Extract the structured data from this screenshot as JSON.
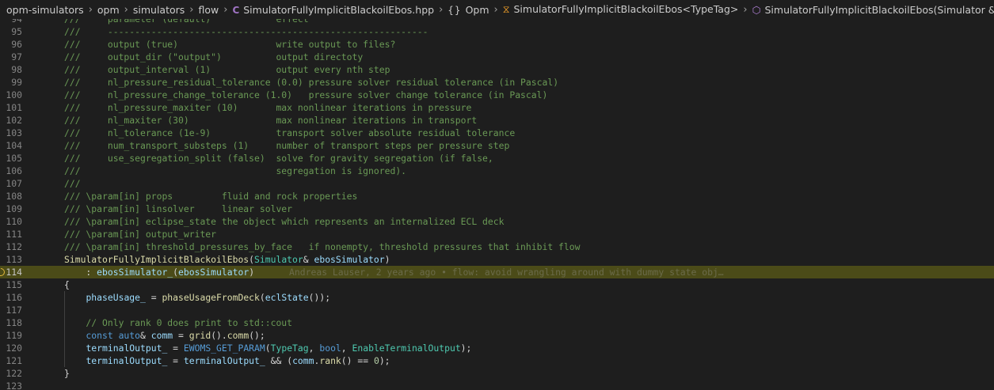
{
  "breadcrumb": {
    "items": [
      {
        "label": "opm-simulators",
        "icon": ""
      },
      {
        "label": "opm",
        "icon": ""
      },
      {
        "label": "simulators",
        "icon": ""
      },
      {
        "label": "flow",
        "icon": ""
      },
      {
        "label": "SimulatorFullyImplicitBlackoilEbos.hpp",
        "icon": "cpp-header-file-icon"
      },
      {
        "label": "Opm",
        "icon": "namespace-icon"
      },
      {
        "label": "SimulatorFullyImplicitBlackoilEbos<TypeTag>",
        "icon": "class-icon"
      },
      {
        "label": "SimulatorFullyImplicitBlackoilEbos(Simulator &)",
        "icon": "method-icon"
      }
    ]
  },
  "editor": {
    "current_line": "114",
    "blame": "Andreas Lauser, 2 years ago • flow: avoid wrangling around with dummy state obj…",
    "lines": [
      {
        "n": "94",
        "t": [
          [
            "cm",
            "///     parameter (default)            effect"
          ]
        ]
      },
      {
        "n": "95",
        "t": [
          [
            "cm",
            "///     -----------------------------------------------------------"
          ]
        ]
      },
      {
        "n": "96",
        "t": [
          [
            "cm",
            "///     output (true)                  write output to files?"
          ]
        ]
      },
      {
        "n": "97",
        "t": [
          [
            "cm",
            "///     output_dir (\"output\")          output directoty"
          ]
        ]
      },
      {
        "n": "98",
        "t": [
          [
            "cm",
            "///     output_interval (1)            output every nth step"
          ]
        ]
      },
      {
        "n": "99",
        "t": [
          [
            "cm",
            "///     nl_pressure_residual_tolerance (0.0) pressure solver residual tolerance (in Pascal)"
          ]
        ]
      },
      {
        "n": "100",
        "t": [
          [
            "cm",
            "///     nl_pressure_change_tolerance (1.0)   pressure solver change tolerance (in Pascal)"
          ]
        ]
      },
      {
        "n": "101",
        "t": [
          [
            "cm",
            "///     nl_pressure_maxiter (10)       max nonlinear iterations in pressure"
          ]
        ]
      },
      {
        "n": "102",
        "t": [
          [
            "cm",
            "///     nl_maxiter (30)                max nonlinear iterations in transport"
          ]
        ]
      },
      {
        "n": "103",
        "t": [
          [
            "cm",
            "///     nl_tolerance (1e-9)            transport solver absolute residual tolerance"
          ]
        ]
      },
      {
        "n": "104",
        "t": [
          [
            "cm",
            "///     num_transport_substeps (1)     number of transport steps per pressure step"
          ]
        ]
      },
      {
        "n": "105",
        "t": [
          [
            "cm",
            "///     use_segregation_split (false)  solve for gravity segregation (if false,"
          ]
        ]
      },
      {
        "n": "106",
        "t": [
          [
            "cm",
            "///                                    segregation is ignored)."
          ]
        ]
      },
      {
        "n": "107",
        "t": [
          [
            "cm",
            "///"
          ]
        ]
      },
      {
        "n": "108",
        "t": [
          [
            "cm",
            "/// \\param[in] props         fluid and rock properties"
          ]
        ]
      },
      {
        "n": "109",
        "t": [
          [
            "cm",
            "/// \\param[in] linsolver     linear solver"
          ]
        ]
      },
      {
        "n": "110",
        "t": [
          [
            "cm",
            "/// \\param[in] eclipse_state the object which represents an internalized ECL deck"
          ]
        ]
      },
      {
        "n": "111",
        "t": [
          [
            "cm",
            "/// \\param[in] output_writer"
          ]
        ]
      },
      {
        "n": "112",
        "t": [
          [
            "cm",
            "/// \\param[in] threshold_pressures_by_face   if nonempty, threshold pressures that inhibit flow"
          ]
        ]
      },
      {
        "n": "113",
        "t": [
          [
            "fn",
            "SimulatorFullyImplicitBlackoilEbos"
          ],
          [
            "pl",
            "("
          ],
          [
            "ty",
            "Simulator"
          ],
          [
            "pl",
            "& "
          ],
          [
            "var",
            "ebosSimulator"
          ],
          [
            "pl",
            ")"
          ]
        ]
      },
      {
        "n": "114",
        "t": [
          [
            "pl",
            "    : "
          ],
          [
            "var",
            "ebosSimulator_"
          ],
          [
            "pl",
            "("
          ],
          [
            "var",
            "ebosSimulator"
          ],
          [
            "pl",
            ")"
          ]
        ]
      },
      {
        "n": "115",
        "t": [
          [
            "pl",
            "{"
          ]
        ]
      },
      {
        "n": "116",
        "t": [
          [
            "pl",
            "    "
          ],
          [
            "var",
            "phaseUsage_"
          ],
          [
            "pl",
            " = "
          ],
          [
            "fn",
            "phaseUsageFromDeck"
          ],
          [
            "pl",
            "("
          ],
          [
            "var",
            "eclState"
          ],
          [
            "pl",
            "());"
          ]
        ]
      },
      {
        "n": "117",
        "t": []
      },
      {
        "n": "118",
        "t": [
          [
            "cm",
            "    // Only rank 0 does print to std::cout"
          ]
        ]
      },
      {
        "n": "119",
        "t": [
          [
            "kw",
            "    const "
          ],
          [
            "kw",
            "auto"
          ],
          [
            "pl",
            "& "
          ],
          [
            "var",
            "comm"
          ],
          [
            "pl",
            " = "
          ],
          [
            "fn",
            "grid"
          ],
          [
            "pl",
            "()."
          ],
          [
            "fn",
            "comm"
          ],
          [
            "pl",
            "();"
          ]
        ]
      },
      {
        "n": "120",
        "t": [
          [
            "pl",
            "    "
          ],
          [
            "var",
            "terminalOutput_"
          ],
          [
            "pl",
            " = "
          ],
          [
            "mac",
            "EWOMS_GET_PARAM"
          ],
          [
            "pl",
            "("
          ],
          [
            "ty",
            "TypeTag"
          ],
          [
            "pl",
            ", "
          ],
          [
            "kw",
            "bool"
          ],
          [
            "pl",
            ", "
          ],
          [
            "ty",
            "EnableTerminalOutput"
          ],
          [
            "pl",
            ");"
          ]
        ]
      },
      {
        "n": "121",
        "t": [
          [
            "pl",
            "    "
          ],
          [
            "var",
            "terminalOutput_"
          ],
          [
            "pl",
            " = "
          ],
          [
            "var",
            "terminalOutput_"
          ],
          [
            "pl",
            " && ("
          ],
          [
            "var",
            "comm"
          ],
          [
            "pl",
            "."
          ],
          [
            "fn",
            "rank"
          ],
          [
            "pl",
            "() == "
          ],
          [
            "num",
            "0"
          ],
          [
            "pl",
            ");"
          ]
        ]
      },
      {
        "n": "122",
        "t": [
          [
            "pl",
            "}"
          ]
        ]
      },
      {
        "n": "123",
        "t": []
      }
    ]
  },
  "colors": {
    "background": "#1e1e1e",
    "current_line": "#4b4b18",
    "comment": "#6a9955",
    "function": "#dcdcaa",
    "type": "#4ec9b0",
    "keyword": "#569cd6",
    "variable": "#9cdcfe"
  }
}
